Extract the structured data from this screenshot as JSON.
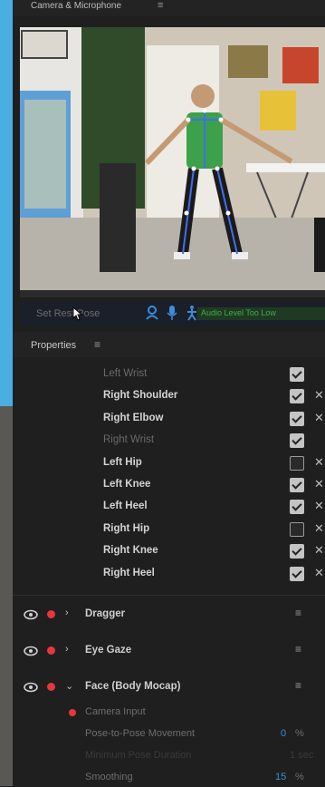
{
  "camera_panel": {
    "title": "Camera & Microphone"
  },
  "controls": {
    "set_rest_pose": "Set Rest Pose",
    "audio_level": "Audio Level Too Low"
  },
  "properties": {
    "title": "Properties",
    "joints": [
      {
        "label": "Left Wrist",
        "checked": true,
        "dim": true,
        "removable": false
      },
      {
        "label": "Right Shoulder",
        "checked": true,
        "dim": false,
        "removable": true
      },
      {
        "label": "Right Elbow",
        "checked": true,
        "dim": false,
        "removable": true
      },
      {
        "label": "Right Wrist",
        "checked": true,
        "dim": true,
        "removable": false
      },
      {
        "label": "Left Hip",
        "checked": false,
        "dim": false,
        "removable": true
      },
      {
        "label": "Left Knee",
        "checked": true,
        "dim": false,
        "removable": true
      },
      {
        "label": "Left Heel",
        "checked": true,
        "dim": false,
        "removable": true
      },
      {
        "label": "Right Hip",
        "checked": false,
        "dim": false,
        "removable": true
      },
      {
        "label": "Right Knee",
        "checked": true,
        "dim": false,
        "removable": true
      },
      {
        "label": "Right Heel",
        "checked": true,
        "dim": false,
        "removable": true
      }
    ]
  },
  "behaviors": {
    "dragger": "Dragger",
    "eye_gaze": "Eye Gaze",
    "face_body_mocap": "Face (Body Mocap)",
    "camera_input": "Camera Input",
    "pose_to_pose": {
      "label": "Pose-to-Pose Movement",
      "value": "0",
      "unit": "%"
    },
    "min_pose_duration": {
      "label": "Minimum Pose Duration",
      "value": "",
      "unit": "1 sec"
    },
    "smoothing": {
      "label": "Smoothing",
      "value": "15",
      "unit": "%"
    }
  },
  "colors": {
    "accent_blue": "#3b8edb",
    "record_red": "#e6383a",
    "audio_green": "#3fae4a"
  }
}
